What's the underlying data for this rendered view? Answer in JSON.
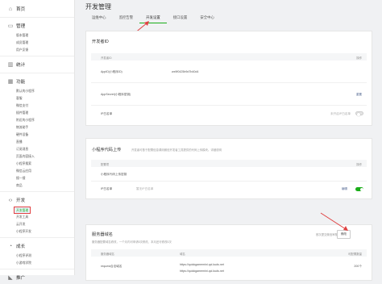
{
  "sidebar": {
    "home": "首页",
    "manage": {
      "title": "管理",
      "items": [
        "版本管理",
        "成员管理",
        "用户反馈"
      ]
    },
    "stats": "统计",
    "features": {
      "title": "功能",
      "items": [
        "默认的小程序",
        "客服",
        "微信支付",
        "插件管理",
        "附近的小程序",
        "物流助手",
        "硬件设备",
        "直播",
        "订阅消息",
        "页面内容接入",
        "小程序搜索",
        "微信云应用",
        "搜一搜",
        "商品"
      ]
    },
    "dev": {
      "title": "开发",
      "items": [
        "开发管理",
        "开发工具",
        "云开发",
        "小程序开发"
      ]
    },
    "growth": {
      "title": "成长",
      "items": [
        "小程序评测",
        "小游戏学院"
      ]
    },
    "promo": "推广"
  },
  "page": {
    "title": "开发管理",
    "tabs": [
      "运维中心",
      "监控告警",
      "开发设置",
      "接口设置",
      "安全中心"
    ],
    "active_tab": 2
  },
  "dev_id": {
    "title": "开发者ID",
    "col_id": "开发者ID",
    "col_op": "操作",
    "appid_label": "AppID(小程序ID)",
    "appid_value": "wx9f0425b9d7b40d4",
    "secret_label": "AppSecret(小程序密钥)",
    "secret_action": "重置",
    "ip_label": "IP白名单",
    "ip_note": "未开启IP白名单"
  },
  "upload": {
    "title": "小程序代码上传",
    "sub": "开发者可基于配置信息调用微信开发者工具提供的代码上传模块。详细说明",
    "col_config": "配置项",
    "col_op": "操作",
    "row1": "小程序代码上传密钥",
    "row2_label": "IP白名单",
    "row2_value": "暂无IP白名单",
    "row2_action": "编辑"
  },
  "server": {
    "title": "服务器域名",
    "sub": "服务器配置域名修改，一个月内可申请5次修改，本月还可修改5次",
    "note": "首次提交微信审核",
    "modify": "修改",
    "col_type": "服务器域名",
    "col_domain": "域名",
    "col_port": "可配置数量",
    "row_type": "request合法域名",
    "domains": [
      "https://quickgamemini.qci.kuds.net",
      "https://quickgamemini.qci.kuds.net"
    ],
    "count": "200个"
  },
  "colors": {
    "accent": "#1aad19",
    "link": "#576b95",
    "highlight": "#e04040"
  }
}
